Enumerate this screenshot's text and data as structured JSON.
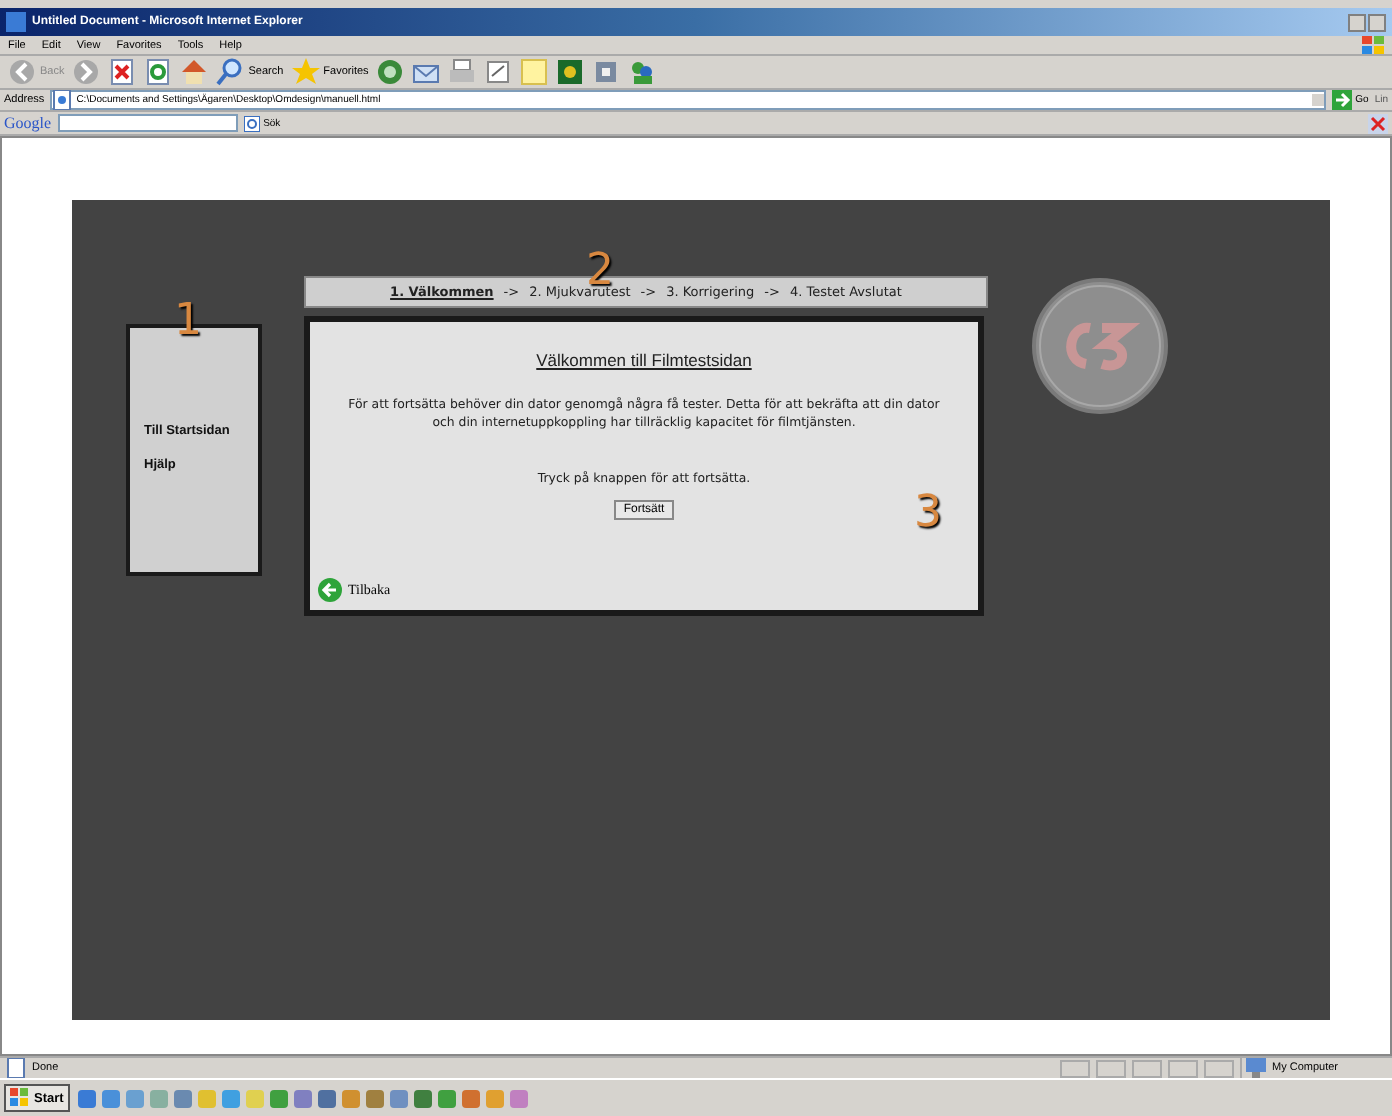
{
  "window": {
    "title": "Untitled Document - Microsoft Internet Explorer"
  },
  "menu": [
    "File",
    "Edit",
    "View",
    "Favorites",
    "Tools",
    "Help"
  ],
  "toolbar": [
    {
      "kind": "back",
      "label": "Back"
    },
    {
      "kind": "forward"
    },
    {
      "kind": "stop"
    },
    {
      "kind": "refresh"
    },
    {
      "kind": "home"
    },
    {
      "kind": "search",
      "label": "Search"
    },
    {
      "kind": "favorites",
      "label": "Favorites"
    },
    {
      "kind": "media"
    },
    {
      "kind": "mail"
    },
    {
      "kind": "print"
    },
    {
      "kind": "edit"
    },
    {
      "kind": "folder"
    },
    {
      "kind": "game"
    },
    {
      "kind": "tool"
    },
    {
      "kind": "messenger"
    }
  ],
  "address": {
    "label": "Address",
    "value": "C:\\Documents and Settings\\Ägaren\\Desktop\\Omdesign\\manuell.html",
    "go": "Go",
    "links": "Lin"
  },
  "google_bar": {
    "logo": "Google",
    "search": "Sök"
  },
  "page": {
    "annotations": [
      "1",
      "2",
      "3"
    ],
    "side_menu": [
      "Till Startsidan",
      "Hjälp"
    ],
    "steps": [
      {
        "label": "1. Välkommen",
        "selected": true
      },
      {
        "label": "2. Mjukvarutest",
        "selected": false
      },
      {
        "label": "3. Korrigering",
        "selected": false
      },
      {
        "label": "4. Testet Avslutat",
        "selected": false
      }
    ],
    "step_separator": "->",
    "heading": "Välkommen till Filmtestsidan",
    "intro": "För att fortsätta behöver din dator genomgå några få tester. Detta för att bekräfta att din dator och din internetuppkoppling har tillräcklig kapacitet för filmtjänsten.",
    "prompt": "Tryck på knappen för att fortsätta.",
    "button": "Fortsätt",
    "back": "Tilbaka"
  },
  "status_bar": {
    "text": "Done",
    "zone": "My Computer"
  },
  "taskbar": {
    "start": "Start"
  }
}
